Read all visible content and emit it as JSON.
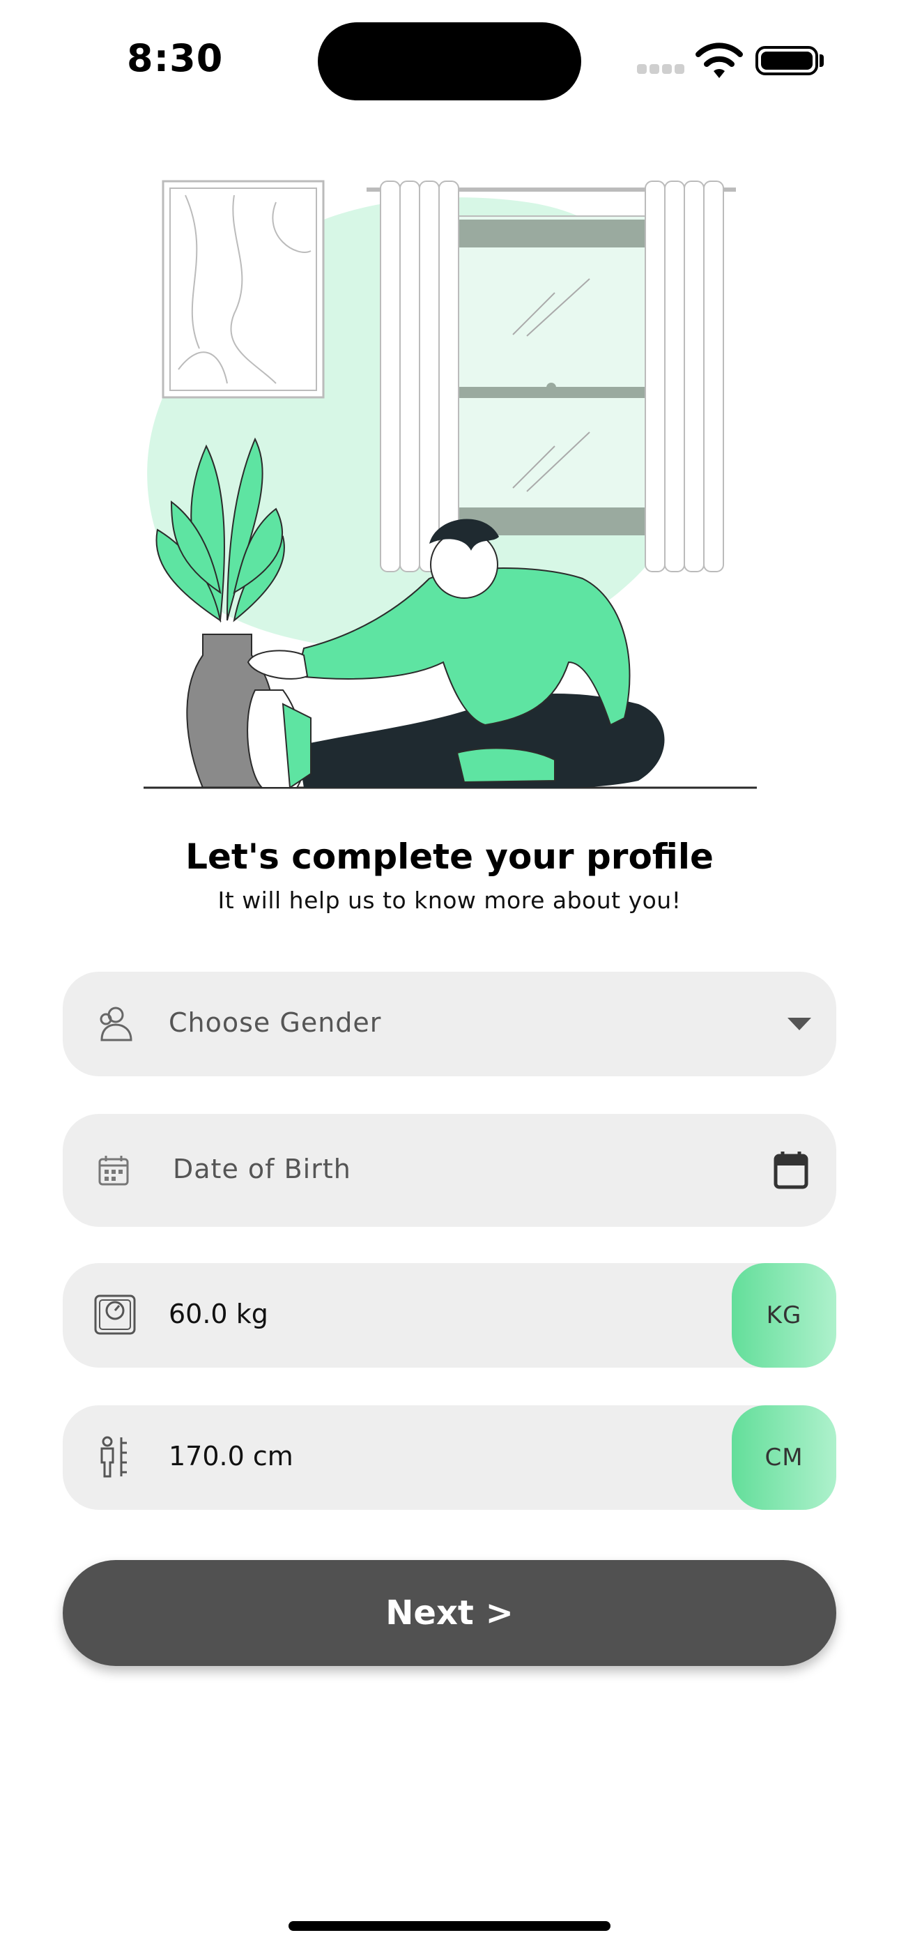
{
  "status_bar": {
    "time": "8:30"
  },
  "header": {
    "title": "Let's complete your profile",
    "subtitle": "It will help us to know more about you!"
  },
  "form": {
    "gender": {
      "placeholder": "Choose Gender",
      "icon": "users-icon",
      "trailing_icon": "dropdown-arrow-icon"
    },
    "dob": {
      "placeholder": "Date of Birth",
      "icon": "calendar-small-icon",
      "trailing_icon": "calendar-icon"
    },
    "weight": {
      "value": "60.0 kg",
      "unit": "KG",
      "icon": "scale-icon"
    },
    "height": {
      "value": "170.0 cm",
      "unit": "CM",
      "icon": "height-icon"
    }
  },
  "next_button": {
    "label": "Next >"
  },
  "colors": {
    "accent": "#5ee4a2",
    "button": "#515151",
    "field": "#eeeeee"
  }
}
